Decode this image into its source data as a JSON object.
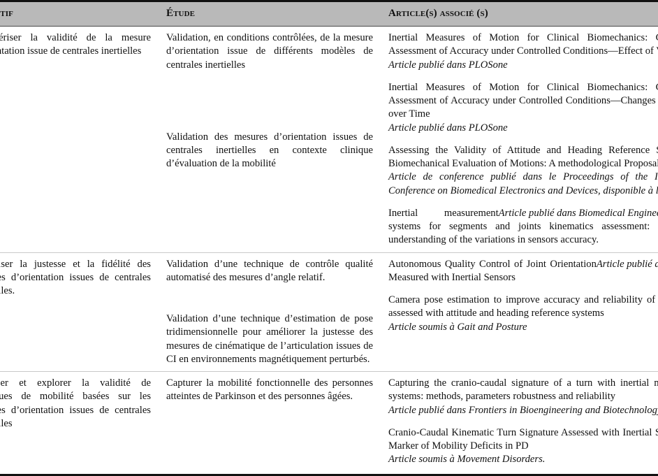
{
  "table": {
    "headers": {
      "objectif": "Objectif",
      "etude": "Étude",
      "article": "Article(s) associé (s)"
    },
    "rows": [
      {
        "objectif": "Caractériser la validité de la mesure d’orientation issue de centrales inertielles",
        "studies": [
          {
            "study": "Validation, en conditions contrôlées, de la mesure d’orientation issue de différents modèles de centrales inertielles",
            "articles": [
              {
                "title": "Inertial Measures of Motion for Clinical Biomechanics: Comparative Assessment of Accuracy under Controlled Conditions—Effect of Velocity",
                "ref": "Article publié dans PLOSone",
                "ref_inline": false
              },
              {
                "title": "Inertial Measures of Motion for Clinical Biomechanics: Comparative Assessment of Accuracy under Controlled Conditions—Changes in Accuracy over Time",
                "ref": "Article publié dans PLOSone",
                "ref_inline": false
              }
            ]
          },
          {
            "study": "Validation des mesures d’orientation issues de centrales inertielles en contexte clinique d’évaluation de la mobilité",
            "articles": [
              {
                "title": "Assessing the Validity of Attitude and Heading Reference Systems for Biomechanical Evaluation of Motions: A methodological Proposal",
                "ref": "Article de conference publié dans le Proceedings of the International Conference on Biomedical Electronics and Devices, disponible à l’Annexe B",
                "ref_inline": false
              },
              {
                "title": "Inertial measurement systems for segments and joints kinematics assessment: towards an understanding of the variations in sensors accuracy.",
                "ref": "Article publié dans Biomedical Engineering Online",
                "ref_inline": true
              }
            ]
          }
        ]
      },
      {
        "objectif": "Optimiser la justesse et la fidélité des mesures d’orientation issues de centrales inertielles.",
        "studies": [
          {
            "study": "Validation d’une technique de contrôle qualité automatisé des mesures d’angle relatif.",
            "articles": [
              {
                "title": "Autonomous Quality Control of Joint Orientation Measured with Inertial Sensors",
                "ref": "Article publié dans Sensors",
                "ref_inline": true
              }
            ]
          },
          {
            "study": "Validation d’une technique d’estimation de pose tridimensionnelle pour améliorer la justesse des mesures de cinématique de l’articulation issues de CI en environnements magnétiquement perturbés.",
            "articles": [
              {
                "title": "Camera pose estimation to improve accuracy and reliability of joint angles assessed with attitude and heading reference systems",
                "ref": "Article soumis à Gait and Posture",
                "ref_inline": false
              }
            ]
          }
        ]
      },
      {
        "objectif": "Proposer et explorer la validité de métriques de mobilité basées sur les mesures d’orientation issues de centrales inertielles",
        "studies": [
          {
            "study": "Capturer la mobilité fonctionnelle des personnes atteintes de Parkinson et des personnes âgées.",
            "articles": [
              {
                "title": "Capturing the cranio-caudal signature of a turn with inertial measurement systems: methods, parameters robustness and reliability",
                "ref": "Article publié dans Frontiers in Bioengineering and Biotechnology.",
                "ref_inline": false
              },
              {
                "title": "Cranio-Caudal Kinematic Turn Signature Assessed with Inertial Systems as a Marker of Mobility Deficits in PD",
                "ref": "Article soumis à Movement Disorders.",
                "ref_inline": false
              }
            ]
          }
        ]
      }
    ]
  },
  "style": {
    "header_bg": "#b9b9b9",
    "rule_color": "#111111",
    "divider_color": "#c9c9c9",
    "text_color": "#101010"
  }
}
